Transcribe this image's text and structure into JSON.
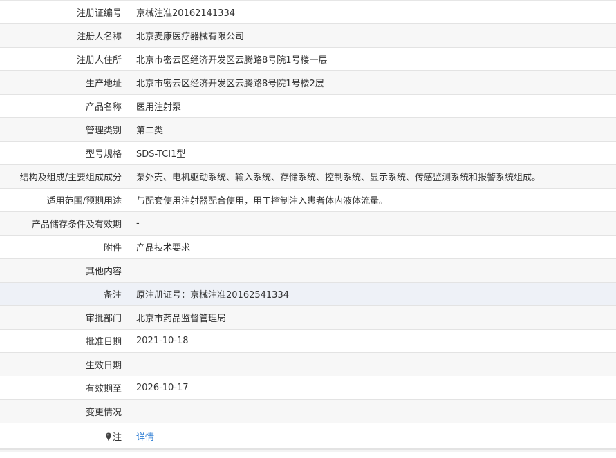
{
  "rows": [
    {
      "label": "注册证编号",
      "value": "京械注准20162141334"
    },
    {
      "label": "注册人名称",
      "value": "北京麦康医疗器械有限公司"
    },
    {
      "label": "注册人住所",
      "value": "北京市密云区经济开发区云腾路8号院1号楼一层"
    },
    {
      "label": "生产地址",
      "value": "北京市密云区经济开发区云腾路8号院1号楼2层"
    },
    {
      "label": "产品名称",
      "value": "医用注射泵"
    },
    {
      "label": "管理类别",
      "value": "第二类"
    },
    {
      "label": "型号规格",
      "value": "SDS-TCI1型"
    },
    {
      "label": "结构及组成/主要组成成分",
      "value": "泵外壳、电机驱动系统、输入系统、存储系统、控制系统、显示系统、传感监测系统和报警系统组成。"
    },
    {
      "label": "适用范围/预期用途",
      "value": "与配套使用注射器配合使用，用于控制注入患者体内液体流量。"
    },
    {
      "label": "产品储存条件及有效期",
      "value": "-"
    },
    {
      "label": "附件",
      "value": "产品技术要求"
    },
    {
      "label": "其他内容",
      "value": ""
    },
    {
      "label": "备注",
      "value": "原注册证号：京械注准20162541334"
    },
    {
      "label": "审批部门",
      "value": "北京市药品监督管理局"
    },
    {
      "label": "批准日期",
      "value": "2021-10-18"
    },
    {
      "label": "生效日期",
      "value": ""
    },
    {
      "label": "有效期至",
      "value": "2026-10-17"
    },
    {
      "label": "变更情况",
      "value": ""
    }
  ],
  "note": {
    "label": "注",
    "link_text": "详情",
    "icon": "pin-icon"
  }
}
